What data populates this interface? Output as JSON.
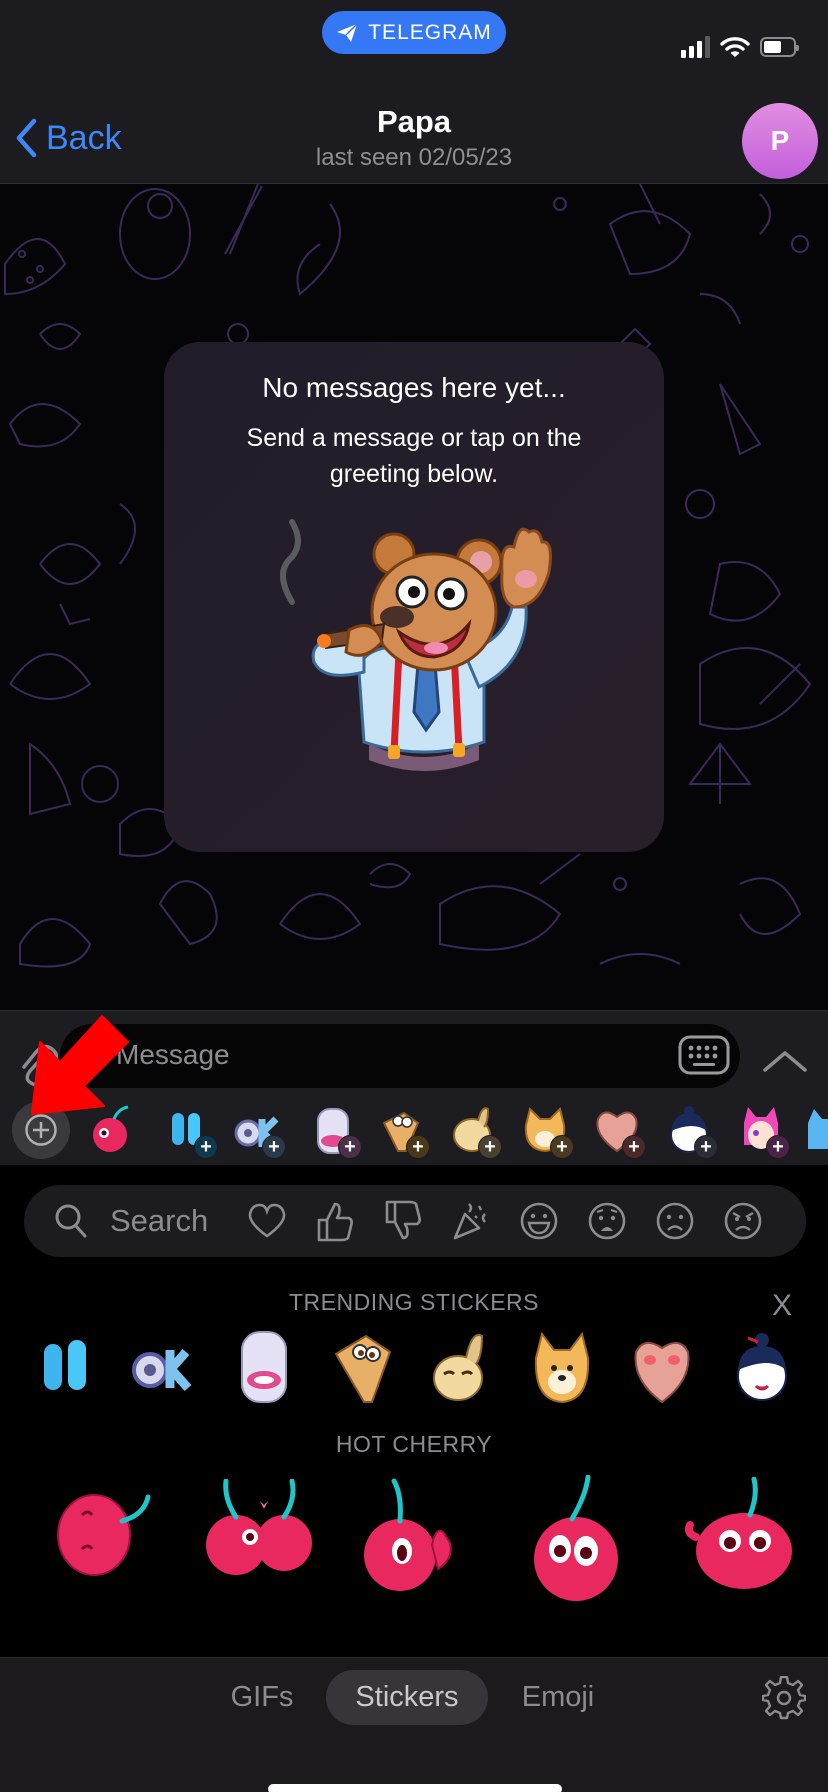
{
  "status_bar": {
    "app_pill": "TELEGRAM",
    "signal_bars": 3,
    "signal_max": 4,
    "battery_level_fraction": 0.6
  },
  "nav": {
    "back_label": "Back",
    "title": "Papa",
    "subtitle": "last seen 02/05/23",
    "avatar_initial": "P"
  },
  "empty_state": {
    "heading": "No messages here yet...",
    "body": "Send a message or tap on the greeting below.",
    "greeting_sticker": "bear-waving-with-cigar-sticker"
  },
  "composer": {
    "placeholder": "Message",
    "keyboard_icon": "keyboard-icon",
    "expand_icon": "chevron-up-icon",
    "attach_icon": "paperclip-icon"
  },
  "sticker_strip": {
    "add_button": "add-sticker-pack",
    "packs": [
      {
        "name": "hot-cherry",
        "installed": true
      },
      {
        "name": "blue-quote",
        "installed": false
      },
      {
        "name": "ok",
        "installed": false
      },
      {
        "name": "white-blob",
        "installed": false
      },
      {
        "name": "dog-face",
        "installed": false
      },
      {
        "name": "bunny",
        "installed": false
      },
      {
        "name": "doge",
        "installed": false
      },
      {
        "name": "pink-heart",
        "installed": false
      },
      {
        "name": "panda-girl",
        "installed": false
      },
      {
        "name": "pink-cat-girl",
        "installed": false
      },
      {
        "name": "blue-cat",
        "installed": false
      }
    ]
  },
  "search": {
    "placeholder": "Search",
    "emoji_filters": [
      "heart",
      "thumbs-up",
      "thumbs-down",
      "party-popper",
      "grinning",
      "anxious",
      "frowning",
      "angry"
    ]
  },
  "sections": {
    "trending_title": "TRENDING STICKERS",
    "trending_close": "X",
    "trending_items": [
      "blue-quote",
      "ok",
      "white-blob",
      "dog-face",
      "bunny",
      "doge",
      "pink-heart",
      "panda-girl"
    ],
    "pack_title": "HOT CHERRY",
    "pack_items": [
      "cherry-sleepy",
      "cherries-kissing",
      "cherry-thumbs-up",
      "cherry-surprised",
      "cherry-happy"
    ]
  },
  "bottom_tabs": {
    "items": [
      {
        "label": "GIFs",
        "active": false
      },
      {
        "label": "Stickers",
        "active": true
      },
      {
        "label": "Emoji",
        "active": false
      }
    ],
    "settings_icon": "gear-icon"
  },
  "annotation": {
    "arrow_color": "#ff0000",
    "points_to": "add-sticker-pack-button"
  },
  "colors": {
    "accent": "#3e88f7",
    "avatar": "#d07ee0",
    "telegram_pill": "#3478f6"
  }
}
